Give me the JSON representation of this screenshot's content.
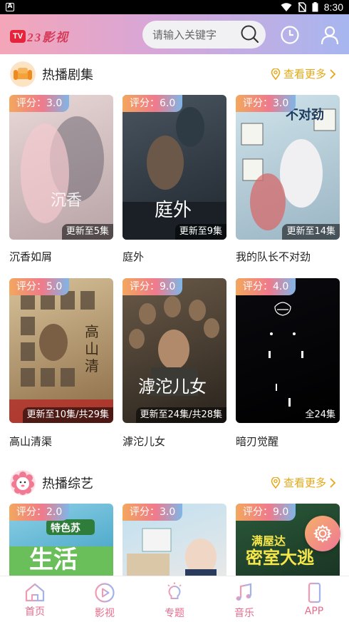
{
  "status_bar": {
    "time": "8:30",
    "app_badge": "A"
  },
  "header": {
    "logo_tv": "TV",
    "logo_brand": "23影视",
    "search_placeholder": "请输入关键字"
  },
  "sections": [
    {
      "title": "热播剧集",
      "more": "查看更多",
      "items": [
        {
          "score": "评分：3.0",
          "update": "更新至5集",
          "title": "沉香如屑",
          "colors": [
            "#e8d8d6",
            "#b8a3a6"
          ]
        },
        {
          "score": "评分：6.0",
          "update": "更新至9集",
          "title": "庭外",
          "colors": [
            "#4a5560",
            "#1f262d"
          ]
        },
        {
          "score": "评分：3.0",
          "update": "更新至14集",
          "title": "我的队长不对劲",
          "colors": [
            "#cfe3ea",
            "#9bb5c4"
          ]
        },
        {
          "score": "评分：5.0",
          "update": "更新至10集/共29集",
          "title": "高山清渠",
          "colors": [
            "#d8c29a",
            "#8a6b45"
          ]
        },
        {
          "score": "评分：9.0",
          "update": "更新至24集/共28集",
          "title": "滹沱儿女",
          "colors": [
            "#6a5a48",
            "#2a241d"
          ]
        },
        {
          "score": "评分：4.0",
          "update": "全24集",
          "title": "暗刃觉醒",
          "colors": [
            "#0a0a0f",
            "#000000"
          ]
        }
      ]
    },
    {
      "title": "热播综艺",
      "more": "查看更多",
      "items": [
        {
          "score": "评分：2.0",
          "title": "",
          "colors": [
            "#8fd0e8",
            "#3a9fc0"
          ]
        },
        {
          "score": "评分：3.0",
          "title": "",
          "colors": [
            "#bfe0f0",
            "#e8e8e8"
          ]
        },
        {
          "score": "评分：9.0",
          "title": "",
          "colors": [
            "#2b5a3a",
            "#1a3524"
          ]
        }
      ]
    }
  ],
  "bottom_nav": [
    {
      "label": "首页",
      "icon": "home-icon"
    },
    {
      "label": "影视",
      "icon": "play-icon"
    },
    {
      "label": "专题",
      "icon": "bulb-icon"
    },
    {
      "label": "音乐",
      "icon": "music-icon"
    },
    {
      "label": "APP",
      "icon": "phone-icon"
    }
  ]
}
